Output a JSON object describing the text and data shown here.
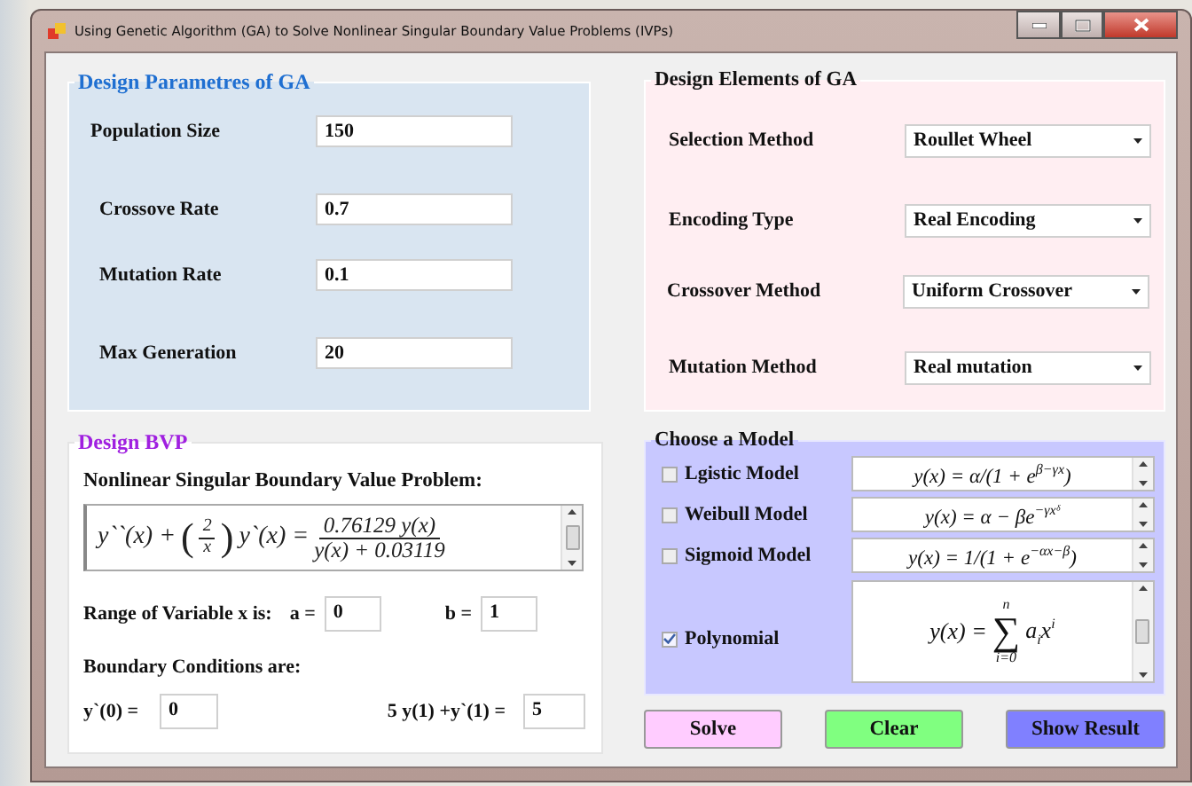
{
  "window": {
    "title": "Using Genetic Algorithm (GA) to Solve Nonlinear Singular Boundary Value Problems (IVPs)"
  },
  "ga_parameters": {
    "title": "Design Parametres of GA",
    "fields": [
      {
        "label": "Population Size",
        "value": "150"
      },
      {
        "label": "Crossove Rate",
        "value": "0.7"
      },
      {
        "label": "Mutation Rate",
        "value": "0.1"
      },
      {
        "label": "Max Generation",
        "value": "20"
      }
    ]
  },
  "ga_elements": {
    "title": "Design Elements of GA",
    "fields": [
      {
        "label": "Selection Method",
        "value": "Roullet Wheel"
      },
      {
        "label": "Encoding Type",
        "value": "Real Encoding"
      },
      {
        "label": "Crossover Method",
        "value": "Uniform Crossover"
      },
      {
        "label": "Mutation Method",
        "value": "Real mutation"
      }
    ]
  },
  "bvp": {
    "title": "Design BVP",
    "problem_label": "Nonlinear Singular Boundary Value Problem:",
    "equation": {
      "lhs": "y``(x) +",
      "open": "(",
      "coef_num": "2",
      "coef_den": "x",
      "close": ")",
      "mid": "y`(x) =",
      "num": "0.76129 y(x)",
      "den": "y(x) + 0.03119"
    },
    "range_label": "Range of Variable x is:",
    "a_label": "a =",
    "a_value": "0",
    "b_label": "b =",
    "b_value": "1",
    "bc_label": "Boundary Conditions are:",
    "conditions": [
      {
        "label": "y`(0) =",
        "value": "0"
      },
      {
        "label": "5 y(1) +y`(1) =",
        "value": "5"
      }
    ]
  },
  "models": {
    "title": "Choose  a Model",
    "items": [
      {
        "label": "Lgistic Model",
        "checked": false,
        "kind": "inline",
        "formula": "y(x) = α/(1 + e$^{β−γx}$)"
      },
      {
        "label": "Weibull Model",
        "checked": false,
        "kind": "inline",
        "formula": "y(x) = α − βe$^{−γxᵟ}$"
      },
      {
        "label": "Sigmoid Model",
        "checked": false,
        "kind": "inline",
        "formula": "y(x) = 1/(1 + e$^{−αx−β}$)"
      },
      {
        "label": "Polynomial",
        "checked": true,
        "kind": "sum",
        "formula": {
          "lhs": "y(x) =",
          "symbol": "∑",
          "upper": "n",
          "lower": "i=0",
          "term": "a$_{i}$x$^{i}$"
        }
      }
    ]
  },
  "buttons": [
    {
      "label": "Solve",
      "color": "#ffccff"
    },
    {
      "label": "Clear",
      "color": "#80ff80"
    },
    {
      "label": "Show Result",
      "color": "#8080ff"
    }
  ]
}
